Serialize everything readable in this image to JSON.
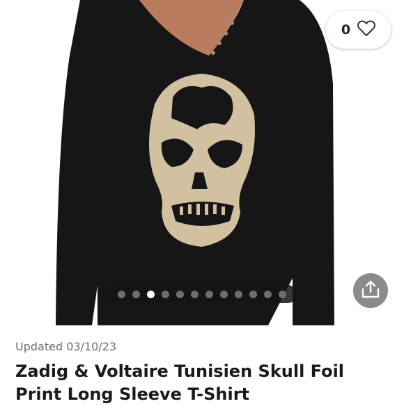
{
  "listing": {
    "image_alt": "Black long sleeve t-shirt with gold skull print",
    "likes": "0",
    "updated": "Updated 03/10/23",
    "title": "Zadig & Voltaire Tunisien Skull Foil Print Long Sleeve T-Shirt"
  },
  "carousel": {
    "total": 12,
    "active_index": 2
  },
  "icons": {
    "like": "heart-icon",
    "share": "share-upload-icon"
  },
  "colors": {
    "shirt": "#161616",
    "foil": "#d2c1a1",
    "share_button": "#8a8a8a"
  }
}
